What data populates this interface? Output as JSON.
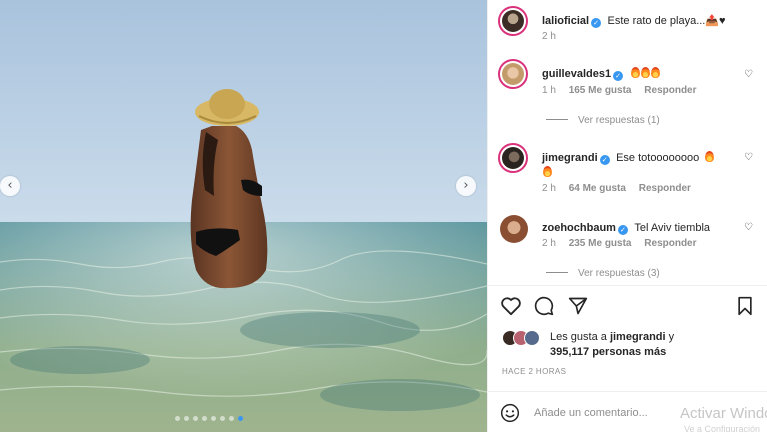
{
  "post": {
    "author": "lalioficial",
    "caption": "Este rato de playa...📤♥",
    "time": "2 h"
  },
  "comments": [
    {
      "user": "guillevaldes1",
      "text": "",
      "fires": 3,
      "time": "1 h",
      "likes": "165 Me gusta",
      "reply": "Responder",
      "view_replies": "Ver respuestas (1)"
    },
    {
      "user": "jimegrandi",
      "text": "Ese totoooooooo",
      "fires": 2,
      "time": "2 h",
      "likes": "64 Me gusta",
      "reply": "Responder",
      "view_replies": ""
    },
    {
      "user": "zoehochbaum",
      "text": "Tel Aviv tiembla",
      "fires": 0,
      "time": "2 h",
      "likes": "235 Me gusta",
      "reply": "Responder",
      "view_replies": "Ver respuestas (3)"
    }
  ],
  "likes": {
    "prefix": "Les gusta a ",
    "user": "jimegrandi",
    "suffix": " y",
    "count": "395,117 personas más"
  },
  "timestamp": "HACE 2 HORAS",
  "add_comment_placeholder": "Añade un comentario...",
  "watermark": {
    "line1": "Activar Windows",
    "line2": "Ve a Configuración"
  },
  "icons": {
    "nav_left": "chevron-left-icon",
    "nav_right": "chevron-right-icon",
    "like": "heart-icon",
    "comment": "comment-icon",
    "share": "paper-plane-icon",
    "save": "bookmark-icon",
    "emoji": "emoji-icon",
    "verified": "verified-badge-icon",
    "fire": "fire-emoji-icon"
  },
  "carousel": {
    "count": 8,
    "active_index": 7
  },
  "colors": {
    "verified": "#3897f0",
    "story_ring": "#d9317a",
    "active_dot": "#3a97f0"
  }
}
